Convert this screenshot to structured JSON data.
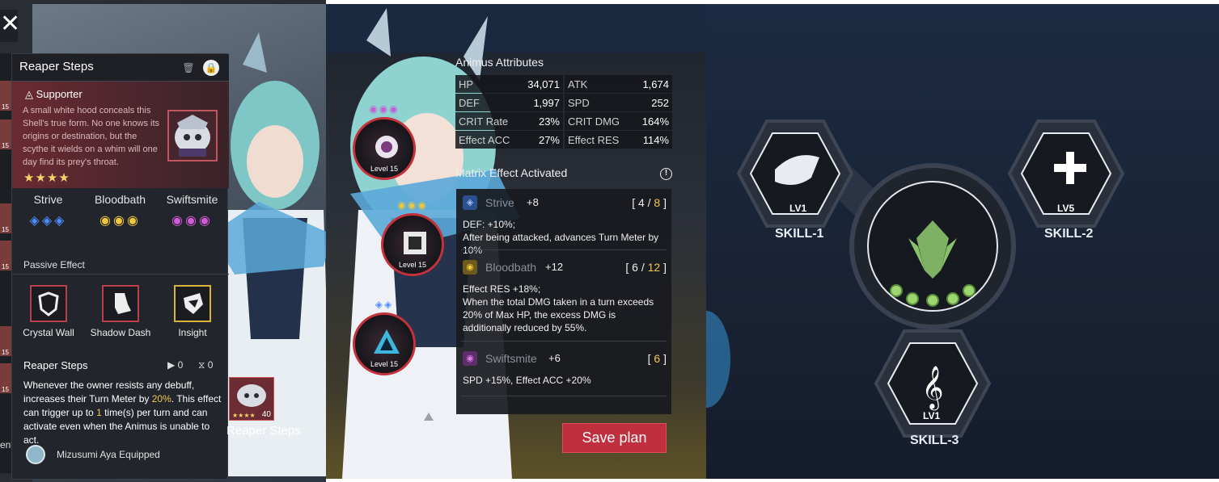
{
  "panel1": {
    "close_icon": "close-icon",
    "strip_numbers": [
      "15",
      "15",
      "15",
      "15",
      "15",
      "15",
      "15"
    ],
    "left_bottom_text": "ent",
    "card": {
      "title": "Reaper Steps",
      "role": "Supporter",
      "description": "A small white hood conceals this Shell's true form. No one knows its origins or destination, but the scythe it wields on a whim will one day find its prey's throat.",
      "stars": "★★★★",
      "effects": [
        {
          "name": "Strive",
          "icons": "◈◈◈",
          "color": "#4f8cff"
        },
        {
          "name": "Bloodbath",
          "icons": "◉◉◉",
          "color": "#f0c83a"
        },
        {
          "name": "Swiftsmite",
          "icons": "◉◉◉",
          "color": "#d35ad8"
        }
      ],
      "passive_label": "Passive Effect",
      "passive_skills": [
        {
          "name": "Crystal Wall",
          "border": "#b93f4c"
        },
        {
          "name": "Shadow Dash",
          "border": "#b93f4c"
        },
        {
          "name": "Insight",
          "border": "#d9b33a"
        }
      ],
      "reaper_label": "Reaper Steps",
      "reaper_play": "▶ 0",
      "reaper_hourglass": "⧖ 0",
      "reaper_desc_1": "Whenever the owner resists any debuff, increases their Turn Meter by ",
      "reaper_desc_pct": "20%",
      "reaper_desc_2": ". This effect can trigger up to ",
      "reaper_desc_times": "1",
      "reaper_desc_3": " time(s) per turn and can activate even when the Animus is unable to act.",
      "equipped_text": "Mizusumi Aya  Equipped"
    }
  },
  "panel2": {
    "cores": [
      {
        "gems": "◉◉◉",
        "gem_color": "#c45ad8",
        "level": "Level 15"
      },
      {
        "gems": "◉◉◉",
        "gem_color": "#f0c83a",
        "level": "Level 15"
      },
      {
        "gems": "◈◈",
        "gem_color": "#4f8cff",
        "level": "Level 15"
      }
    ],
    "equip_level": "40",
    "equip_stars": "★★★★",
    "equip_name": "Reaper Steps",
    "attributes_title": "Animus Attributes",
    "attributes": [
      [
        {
          "k": "HP",
          "v": "34,071"
        },
        {
          "k": "ATK",
          "v": "1,674"
        }
      ],
      [
        {
          "k": "DEF",
          "v": "1,997"
        },
        {
          "k": "SPD",
          "v": "252"
        }
      ],
      [
        {
          "k": "CRIT Rate",
          "v": "23%"
        },
        {
          "k": "CRIT DMG",
          "v": "164%"
        }
      ],
      [
        {
          "k": "Effect ACC",
          "v": "27%"
        },
        {
          "k": "Effect RES",
          "v": "114%"
        }
      ]
    ],
    "matrix_title": "Matrix Effect Activated",
    "info_icon": "!",
    "matrix": [
      {
        "name": "Strive",
        "plus": "+8",
        "count_a": "[ 4 / ",
        "count_b": "8",
        "count_c": " ]",
        "desc": "DEF: +10%;\nAfter being attacked, advances Turn Meter by 10%",
        "color": "#4f8cff"
      },
      {
        "name": "Bloodbath",
        "plus": "+12",
        "count_a": "[ 6 / ",
        "count_b": "12",
        "count_c": " ]",
        "desc": "Effect RES +18%;\nWhen the total DMG taken in a turn exceeds 20% of Max HP, the excess DMG is additionally reduced by 55%.",
        "color": "#f0c83a"
      },
      {
        "name": "Swiftsmite",
        "plus": "+6",
        "count_a": "[ ",
        "count_b": "6",
        "count_c": " ]",
        "desc": "SPD +15%, Effect ACC +20%",
        "color": "#d35ad8"
      }
    ],
    "save_label": "Save plan"
  },
  "panel3": {
    "skills": [
      {
        "label": "SKILL-1",
        "level": "LV1"
      },
      {
        "label": "SKILL-2",
        "level": "LV5"
      },
      {
        "label": "SKILL-3",
        "level": "LV1"
      }
    ],
    "center_icon": "emblem-icon"
  }
}
